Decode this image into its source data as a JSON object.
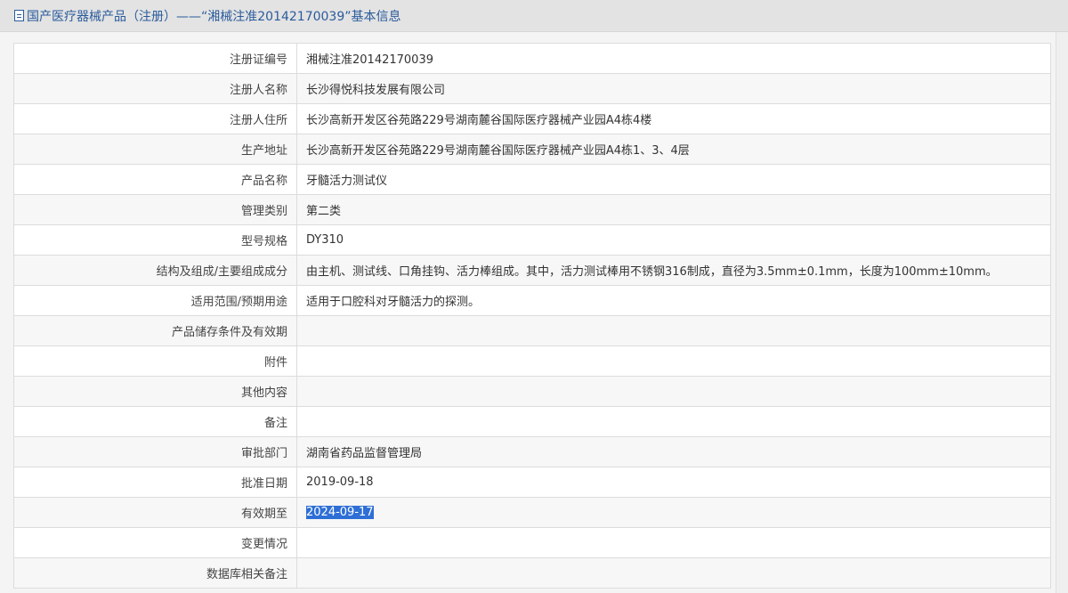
{
  "header": {
    "title": "国产医疗器械产品（注册）——“湘械注准20142170039”基本信息"
  },
  "rows": [
    {
      "label": "注册证编号",
      "value": "湘械注准20142170039"
    },
    {
      "label": "注册人名称",
      "value": "长沙得悦科技发展有限公司"
    },
    {
      "label": "注册人住所",
      "value": "长沙高新开发区谷苑路229号湖南麓谷国际医疗器械产业园A4栋4楼"
    },
    {
      "label": "生产地址",
      "value": "长沙高新开发区谷苑路229号湖南麓谷国际医疗器械产业园A4栋1、3、4层"
    },
    {
      "label": "产品名称",
      "value": "牙髓活力测试仪"
    },
    {
      "label": "管理类别",
      "value": "第二类"
    },
    {
      "label": "型号规格",
      "value": "DY310"
    },
    {
      "label": "结构及组成/主要组成成分",
      "value": "由主机、测试线、口角挂钩、活力棒组成。其中，活力测试棒用不锈钢316制成，直径为3.5mm±0.1mm，长度为100mm±10mm。"
    },
    {
      "label": "适用范围/预期用途",
      "value": "适用于口腔科对牙髓活力的探测。"
    },
    {
      "label": "产品储存条件及有效期",
      "value": ""
    },
    {
      "label": "附件",
      "value": ""
    },
    {
      "label": "其他内容",
      "value": ""
    },
    {
      "label": "备注",
      "value": ""
    },
    {
      "label": "审批部门",
      "value": "湖南省药品监督管理局"
    },
    {
      "label": "批准日期",
      "value": "2019-09-18"
    },
    {
      "label": "有效期至",
      "value": "2024-09-17"
    },
    {
      "label": "变更情况",
      "value": ""
    },
    {
      "label": "数据库相关备注",
      "value": ""
    }
  ],
  "colors": {
    "title_text": "#2a5b9c",
    "selection_highlight": "#2e6fd6"
  }
}
